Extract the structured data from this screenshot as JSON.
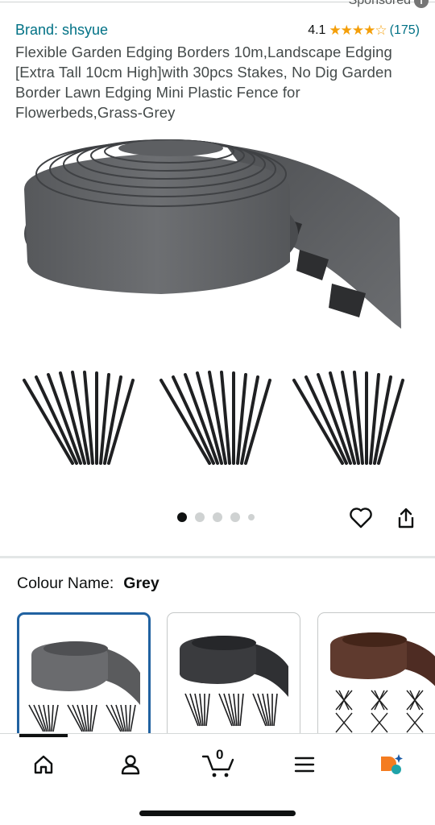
{
  "sponsored_label": "Sponsored",
  "product": {
    "brand": "Brand: shsyue",
    "rating": "4.1",
    "stars": "★★★★☆",
    "review_count": "(175)",
    "title": "Flexible Garden Edging Borders 10m,Landscape Edging [Extra Tall 10cm High]with 30pcs Stakes, No Dig Garden Border Lawn Edging Mini Plastic Fence for Flowerbeds,Grass-Grey"
  },
  "gallery": {
    "total_images": 5,
    "active_index": 0
  },
  "variant": {
    "label": "Colour Name:",
    "selected": "Grey",
    "options": [
      {
        "name": "Grey",
        "color": "#5a5b5d"
      },
      {
        "name": "Black",
        "color": "#2f3033"
      },
      {
        "name": "Brown",
        "color": "#5b3328"
      }
    ]
  },
  "nav": {
    "cart_count": "0",
    "items": [
      "home-icon",
      "account-icon",
      "cart-icon",
      "menu-icon",
      "rufus-icon"
    ]
  },
  "colors": {
    "link": "#007185",
    "star": "#f49f0a",
    "selected_border": "#2162a1"
  }
}
